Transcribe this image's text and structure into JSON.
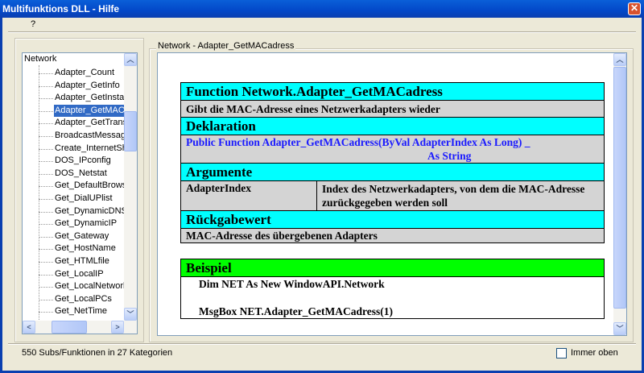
{
  "window": {
    "title": "Multifunktions DLL - Hilfe",
    "close": "✕"
  },
  "menu": {
    "help": "?"
  },
  "tree": {
    "root": "Network",
    "items": [
      "Adapter_Count",
      "Adapter_GetInfo",
      "Adapter_GetInstal",
      "Adapter_GetMAC",
      "Adapter_GetTrans",
      "BroadcastMessag",
      "Create_InternetSh",
      "DOS_IPconfig",
      "DOS_Netstat",
      "Get_DefaultBrows",
      "Get_DialUPlist",
      "Get_DynamicDNS",
      "Get_DynamicIP",
      "Get_Gateway",
      "Get_HostName",
      "Get_HTMLfile",
      "Get_LocalIP",
      "Get_LocalNetworl",
      "Get_LocalPCs",
      "Get_NetTime"
    ],
    "selected_index": 3
  },
  "panel": {
    "title": "Network - Adapter_GetMACadress"
  },
  "doc": {
    "function_header": "Function Network.Adapter_GetMACadress",
    "description": "Gibt die MAC-Adresse eines Netzwerkadapters wieder",
    "declaration_header": "Deklaration",
    "declaration_line1": "Public Function Adapter_GetMACadress(ByVal AdapterIndex As Long) _",
    "declaration_line2": "As String",
    "arguments_header": "Argumente",
    "arg_name": "AdapterIndex",
    "arg_desc": "Index des Netzwerkadapters, von dem die MAC-Adresse zurückgegeben werden soll",
    "return_header": "Rückgabewert",
    "return_desc": "MAC-Adresse des übergebenen Adapters",
    "example_header": "Beispiel",
    "example_line1": "Dim NET As New WindowAPI.Network",
    "example_line2": "MsgBox NET.Adapter_GetMACadress(1)"
  },
  "status": {
    "text": "550 Subs/Funktionen in 27 Kategorien",
    "always_on_top_label": "Immer oben",
    "always_on_top": false
  },
  "colors": {
    "header": "#00ffff",
    "example_header": "#00ff00",
    "row": "#d4d4d4",
    "declaration": "#1a1aff"
  }
}
